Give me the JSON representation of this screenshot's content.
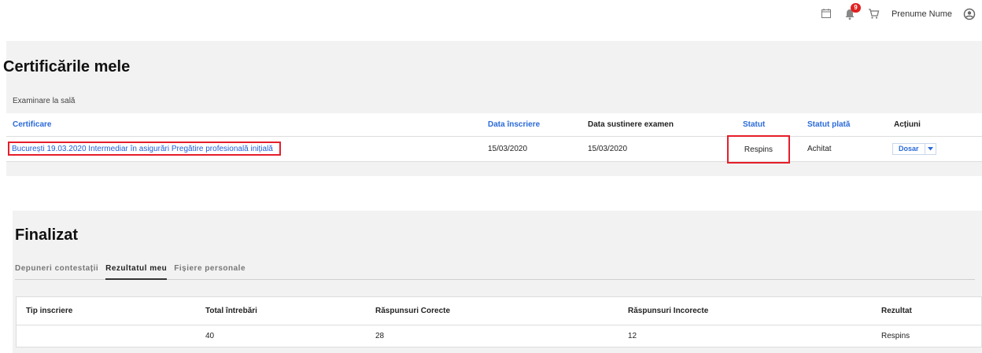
{
  "header": {
    "cropped_top_text": "▁▁▁ ▁▁▁▁▁ ▁▁▁▁ ▁▁▁▁ ▁▁▁▁▁ ▁▁▁▁ ▁▁▁▁▁",
    "notification_count": "9",
    "user_name": "Prenume Nume"
  },
  "certificates": {
    "title": "Certificările mele",
    "subtitle": "Examinare la sală",
    "columns": {
      "certificare": "Certificare",
      "data_inscriere": "Data înscriere",
      "data_sustinere": "Data sustinere examen",
      "statut": "Statut",
      "statut_plata": "Statut plată",
      "actiuni": "Acțiuni"
    },
    "rows": [
      {
        "certificare": "București 19.03.2020 Intermediar în asigurări Pregătire profesională inițială",
        "data_inscriere": "15/03/2020",
        "data_sustinere": "15/03/2020",
        "statut": "Respins",
        "statut_plata": "Achitat",
        "action_label": "Dosar"
      }
    ]
  },
  "finalizat": {
    "title": "Finalizat",
    "tabs": [
      {
        "label": "Depuneri contestații",
        "active": false
      },
      {
        "label": "Rezultatul meu",
        "active": true
      },
      {
        "label": "Fișiere personale",
        "active": false
      }
    ],
    "columns": {
      "tip": "Tip inscriere",
      "total": "Total întrebări",
      "corecte": "Răspunsuri Corecte",
      "incorecte": "Răspunsuri Incorecte",
      "rezultat": "Rezultat"
    },
    "rows": [
      {
        "tip": "",
        "total": "40",
        "corecte": "28",
        "incorecte": "12",
        "rezultat": "Respins"
      }
    ]
  },
  "colors": {
    "link_blue": "#1f5fd6",
    "highlight_red": "#e51e2a",
    "badge_red": "#e02020",
    "panel_gray": "#f2f2f2"
  }
}
